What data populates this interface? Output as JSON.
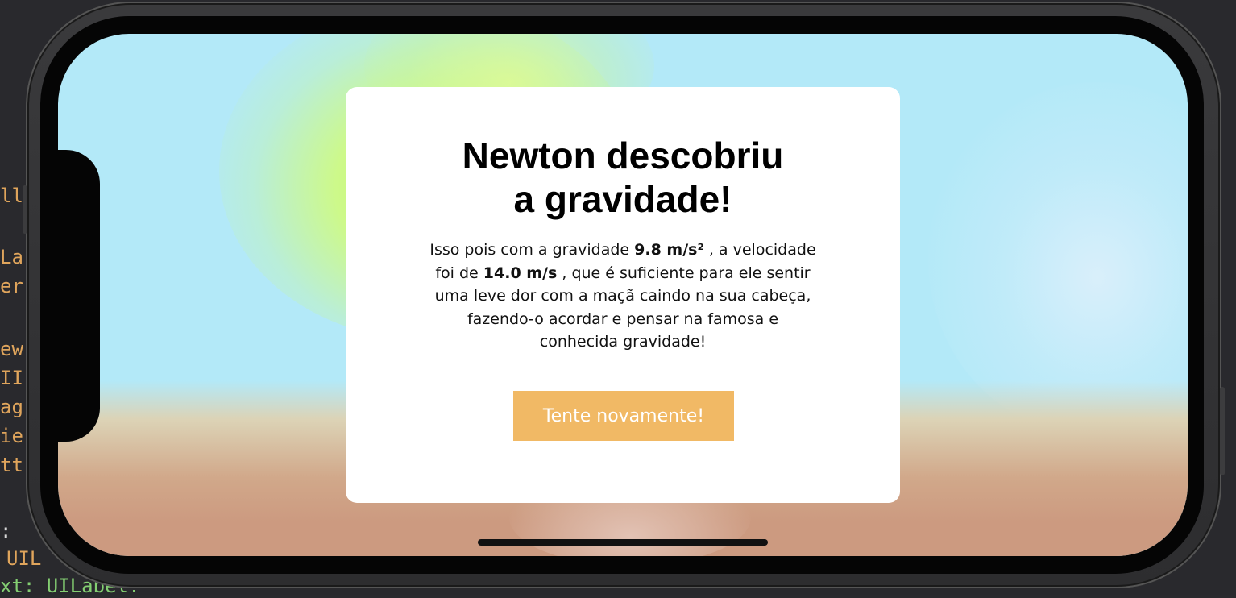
{
  "background_code": {
    "lines": [
      "ll",
      "La",
      "er",
      "ew",
      "II",
      "ag",
      "ie",
      "tt",
      ":",
      "UIL",
      "xt: UILabel!"
    ]
  },
  "modal": {
    "title": "Newton descobriu\na gravidade!",
    "body": {
      "p1": "Isso pois com a gravidade ",
      "gravity": "9.8 m/s²",
      "p2": " , a velocidade foi de ",
      "velocity": "14.0 m/s",
      "p3": " , que é suficiente para ele sentir uma leve dor com a maçã caindo na sua cabeça, fazendo-o acordar e pensar na famosa e conhecida gravidade!"
    },
    "retry_label": "Tente novamente!"
  },
  "colors": {
    "sky": "#b3e9f8",
    "ground": "#cc9a80",
    "button": "#f1b965",
    "modal": "#ffffff"
  }
}
